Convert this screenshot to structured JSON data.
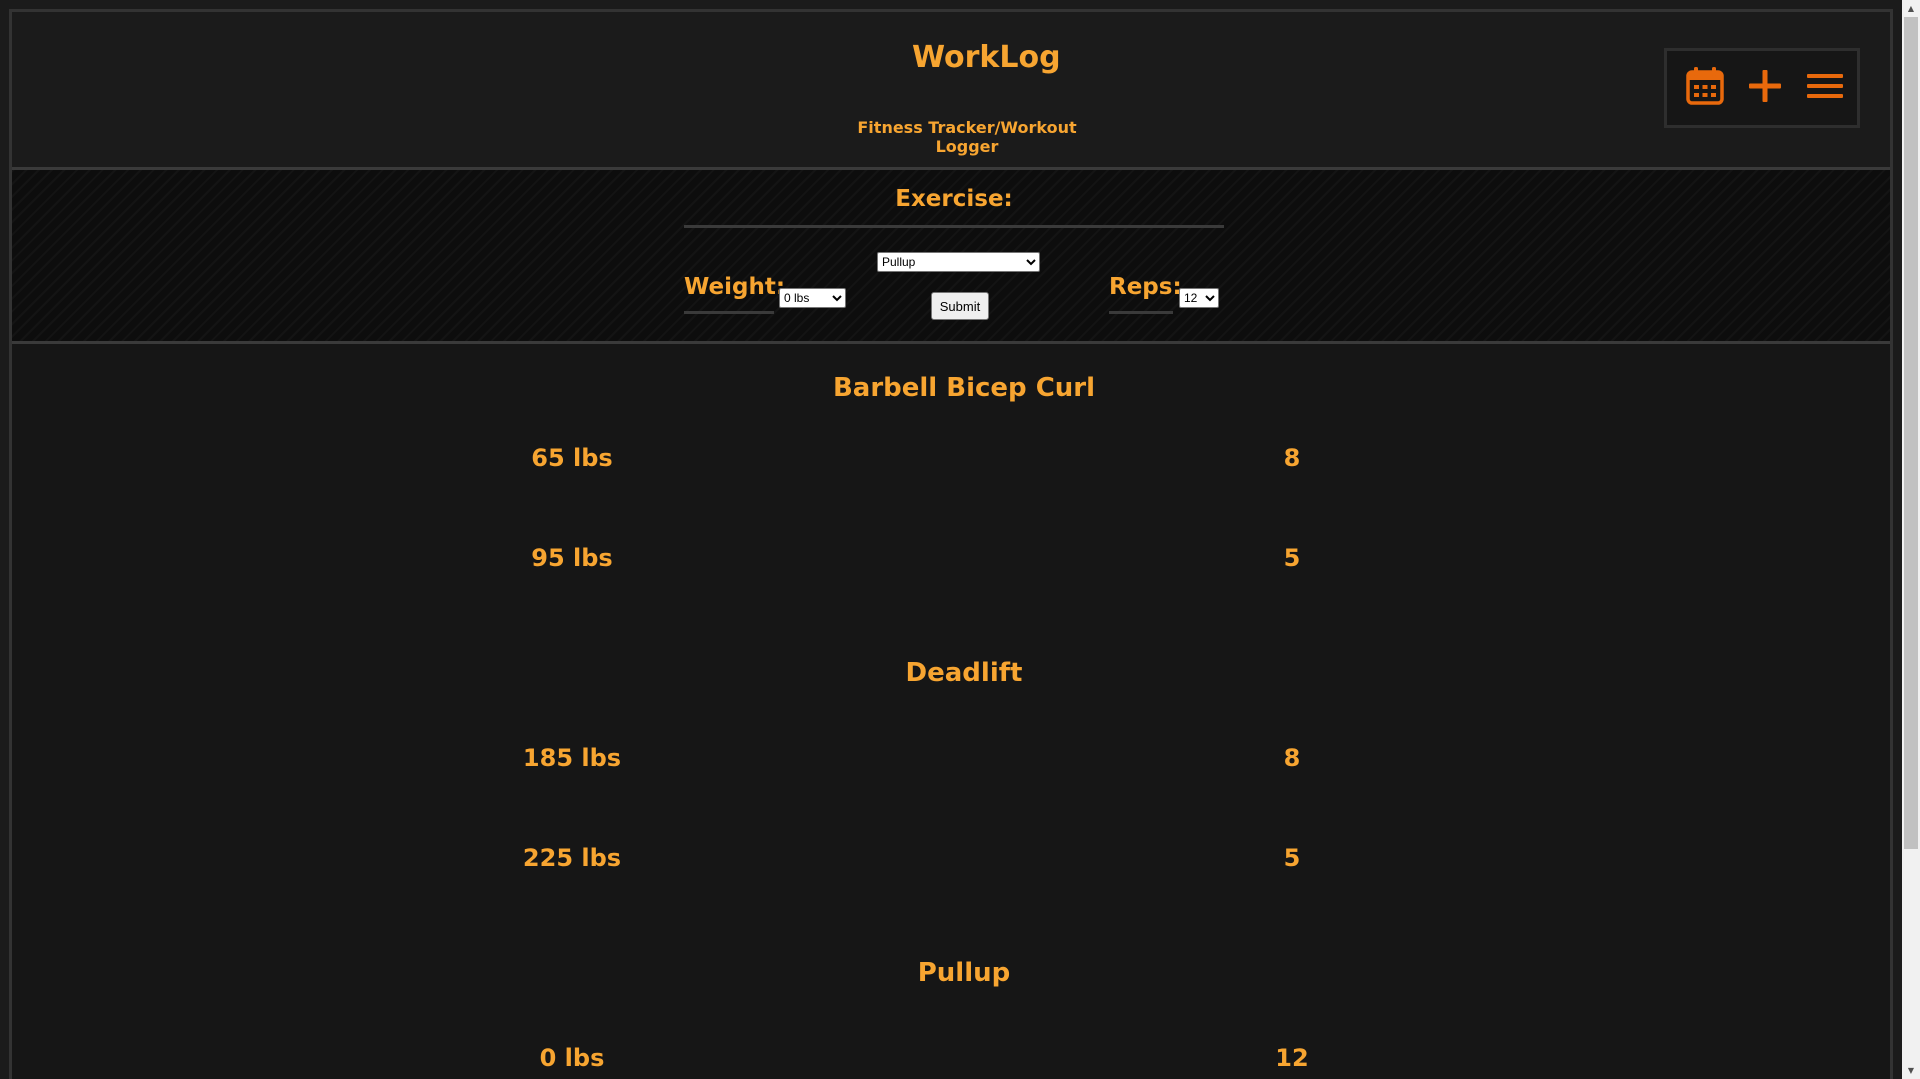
{
  "header": {
    "title": "WorkLog",
    "subtitle": "Fitness Tracker/Workout Logger",
    "toolbar": {
      "icons": [
        "calendar-icon",
        "plus-icon",
        "menu-icon"
      ],
      "accent_color": "#e8690c"
    }
  },
  "form": {
    "exercise_label": "Exercise:",
    "exercise_selected": "Pullup",
    "weight_label": "Weight:",
    "weight_selected": "0 lbs",
    "reps_label": "Reps:",
    "reps_selected": "12",
    "submit_label": "Submit"
  },
  "log": {
    "groups": [
      {
        "exercise": "Barbell Bicep Curl",
        "sets": [
          {
            "weight": "65 lbs",
            "reps": "8"
          },
          {
            "weight": "95 lbs",
            "reps": "5"
          }
        ]
      },
      {
        "exercise": "Deadlift",
        "sets": [
          {
            "weight": "185 lbs",
            "reps": "8"
          },
          {
            "weight": "225 lbs",
            "reps": "5"
          }
        ]
      },
      {
        "exercise": "Pullup",
        "sets": [
          {
            "weight": "0 lbs",
            "reps": "12"
          }
        ]
      }
    ]
  },
  "colors": {
    "text_accent": "#f7a531",
    "icon_accent": "#e8690c",
    "background": "#1b1b1b"
  }
}
